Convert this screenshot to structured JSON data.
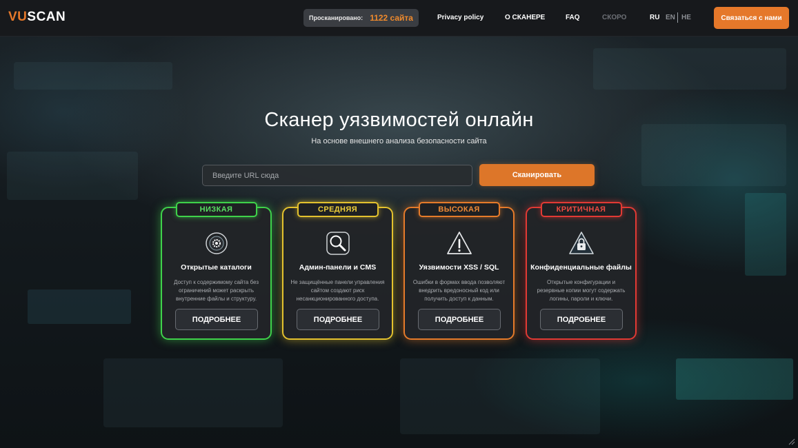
{
  "brand": {
    "logo_part1": "VU",
    "logo_part2": "SCAN",
    "accent_color": "#e5782a"
  },
  "header": {
    "scanned_label": "Просканировано:",
    "scanned_count": "1122 сайта",
    "nav": [
      "Privacy policy",
      "О СКАНЕРЕ",
      "FAQ",
      "СКОРО"
    ],
    "languages": [
      "RU",
      "EN",
      "HE"
    ],
    "active_language": "RU",
    "contact_button": "Связаться с нами"
  },
  "hero": {
    "title": "Сканер уязвимостей онлайн",
    "subtitle": "На основе внешнего анализа безопасности сайта",
    "url_placeholder": "Введите URL сюда",
    "url_value": "",
    "scan_button": "Сканировать"
  },
  "cards": [
    {
      "level": "НИЗКАЯ",
      "level_color": "#3fd24a",
      "icon": "gear-icon",
      "title": "Открытые каталоги",
      "description": "Доступ к содержимому сайта без ограничений может раскрыть внутренние файлы и структуру.",
      "button": "ПОДРОБНЕЕ"
    },
    {
      "level": "СРЕДНЯЯ",
      "level_color": "#e4c22e",
      "icon": "magnifier-icon",
      "title": "Админ-панели и CMS",
      "description": "Не защищённые панели управления сайтом создают риск несанкционированного доступа.",
      "button": "ПОДРОБНЕЕ"
    },
    {
      "level": "ВЫСОКАЯ",
      "level_color": "#e67b2a",
      "icon": "warning-icon",
      "title": "Уязвимости XSS / SQL",
      "description": "Ошибки в формах ввода позволяют внедрить вредоносный код или получить доступ к данным.",
      "button": "ПОДРОБНЕЕ"
    },
    {
      "level": "КРИТИЧНАЯ",
      "level_color": "#e23a34",
      "icon": "locked-warning-icon",
      "title": "Конфиденциальные файлы",
      "description": "Открытые конфигурации и резервные копии могут содержать логины, пароли и ключи.",
      "button": "ПОДРОБНЕЕ"
    }
  ]
}
